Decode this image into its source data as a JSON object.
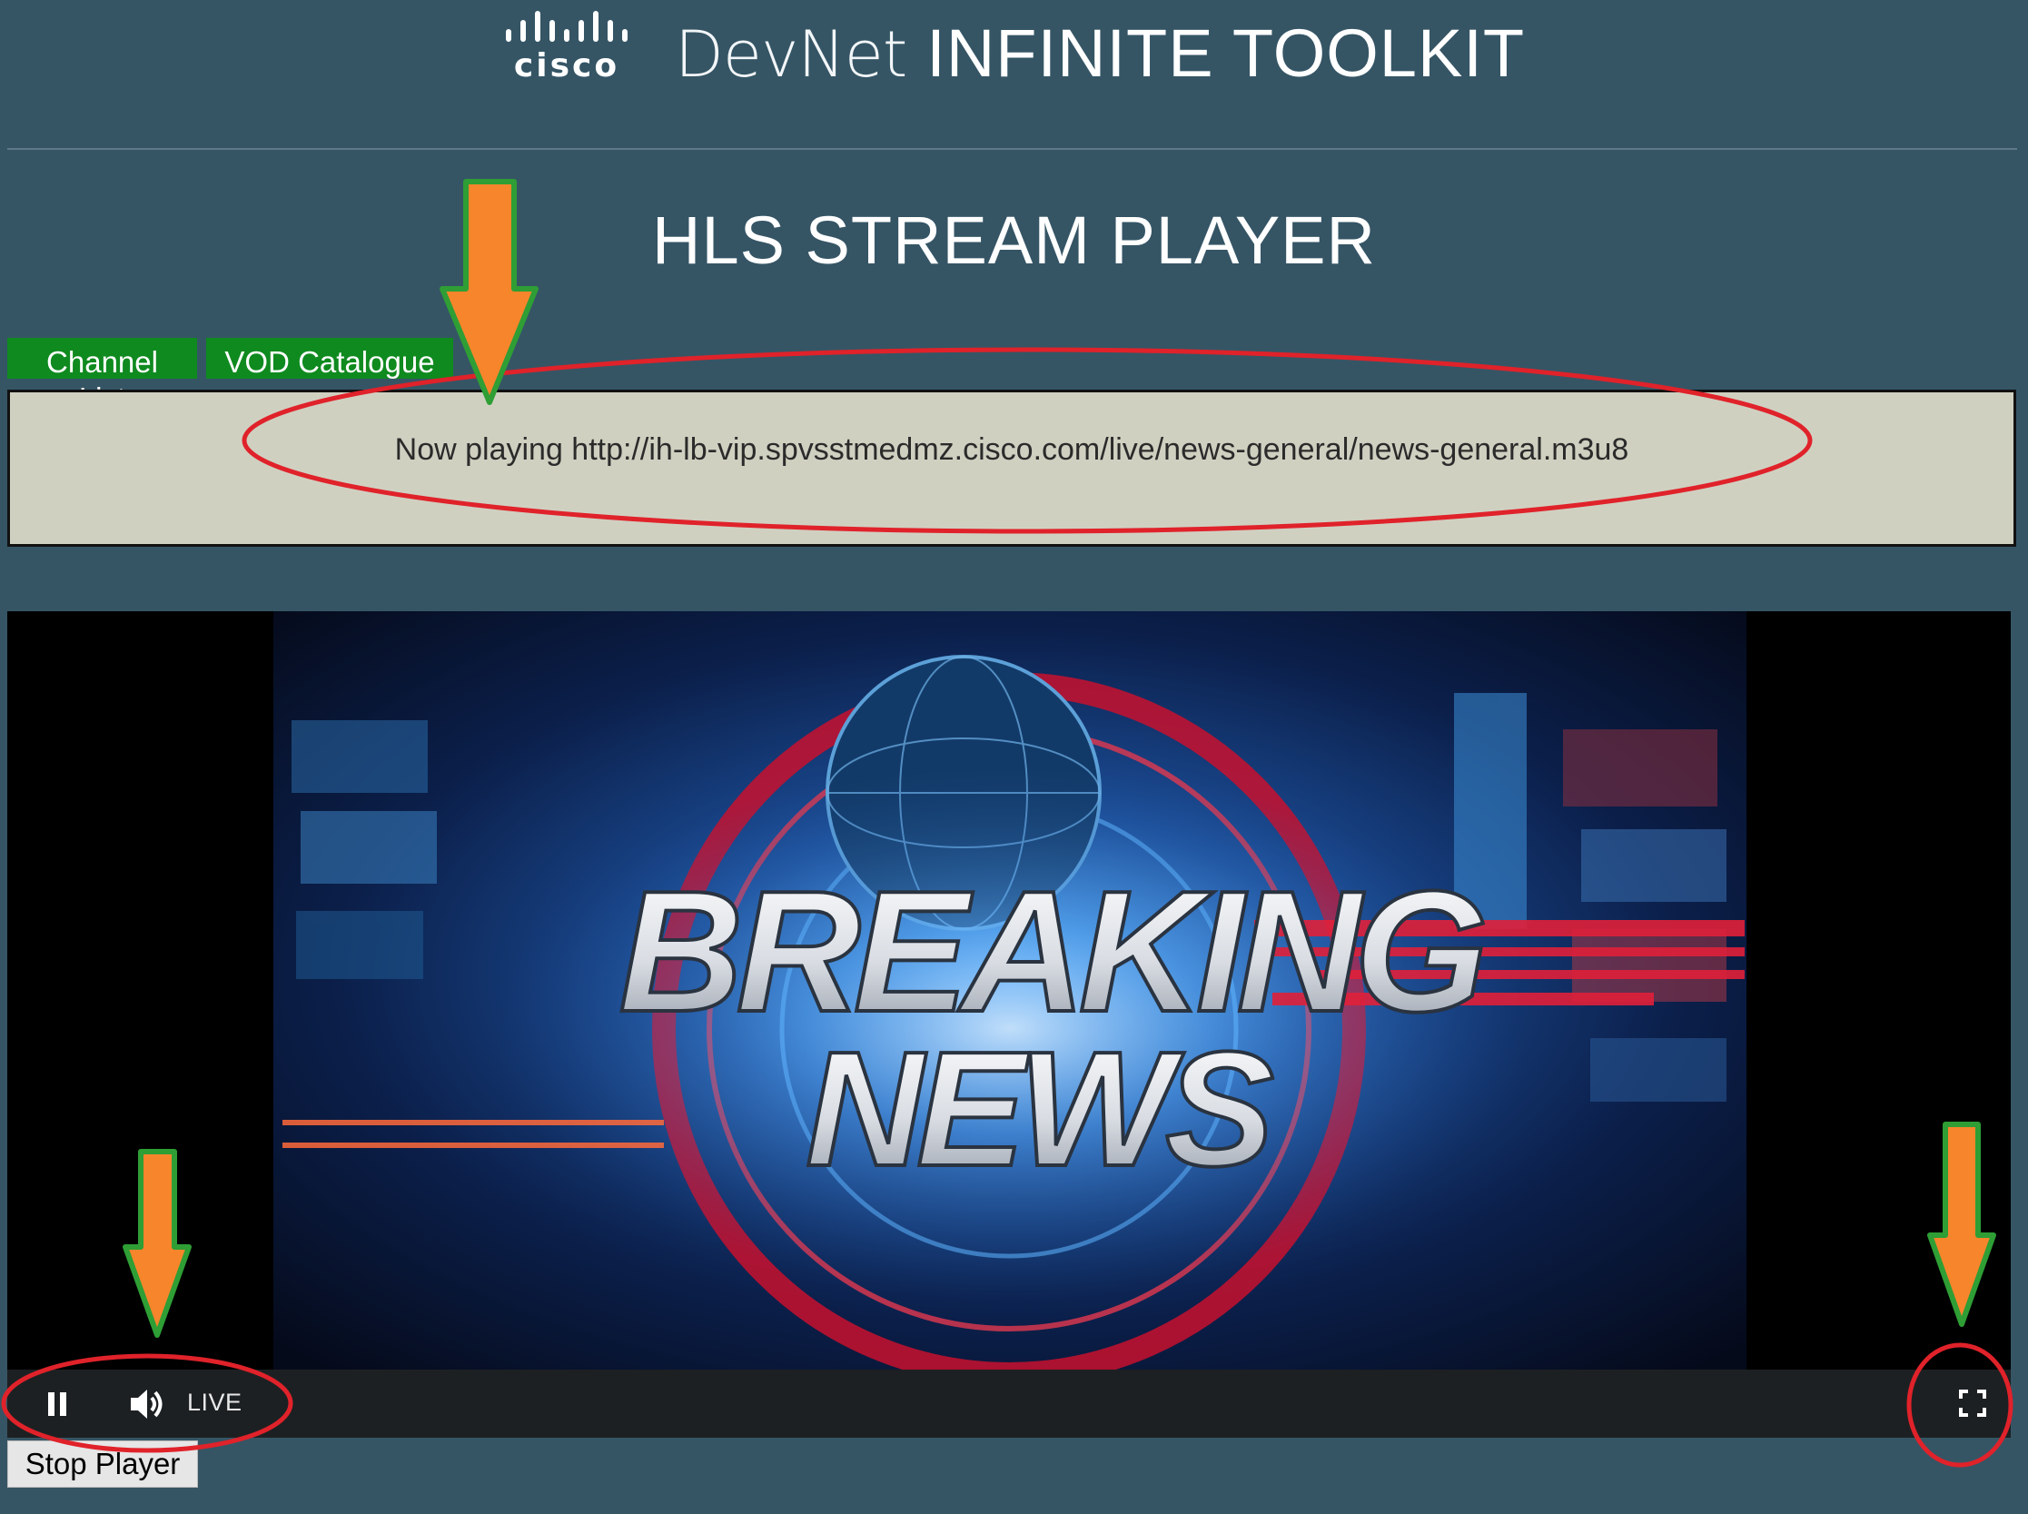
{
  "header": {
    "logo_text": "cisco",
    "brand_prefix": "DevNet",
    "brand_title": "INFINITE TOOLKIT"
  },
  "page": {
    "title": "HLS STREAM PLAYER"
  },
  "tabs": [
    {
      "label": "Channel List"
    },
    {
      "label": "VOD Catalogue"
    }
  ],
  "now_playing": {
    "text": "Now playing http://ih-lb-vip.spvsstmedmz.cisco.com/live/news-general/news-general.m3u8"
  },
  "video": {
    "headline_line1": "BREAKING",
    "headline_line2": "NEWS"
  },
  "controls": {
    "pause_icon": "pause-icon",
    "volume_icon": "volume-icon",
    "live_label": "LIVE",
    "fullscreen_icon": "fullscreen-icon"
  },
  "stop_button": {
    "label": "Stop Player"
  },
  "colors": {
    "page_bg": "#355565",
    "tab_bg": "#0f8a1f",
    "nowplaying_bg": "#d0d0c1",
    "annotation_arrow": "#f7852b",
    "annotation_arrow_outline": "#2e9e35",
    "annotation_circle": "#e0222a"
  }
}
